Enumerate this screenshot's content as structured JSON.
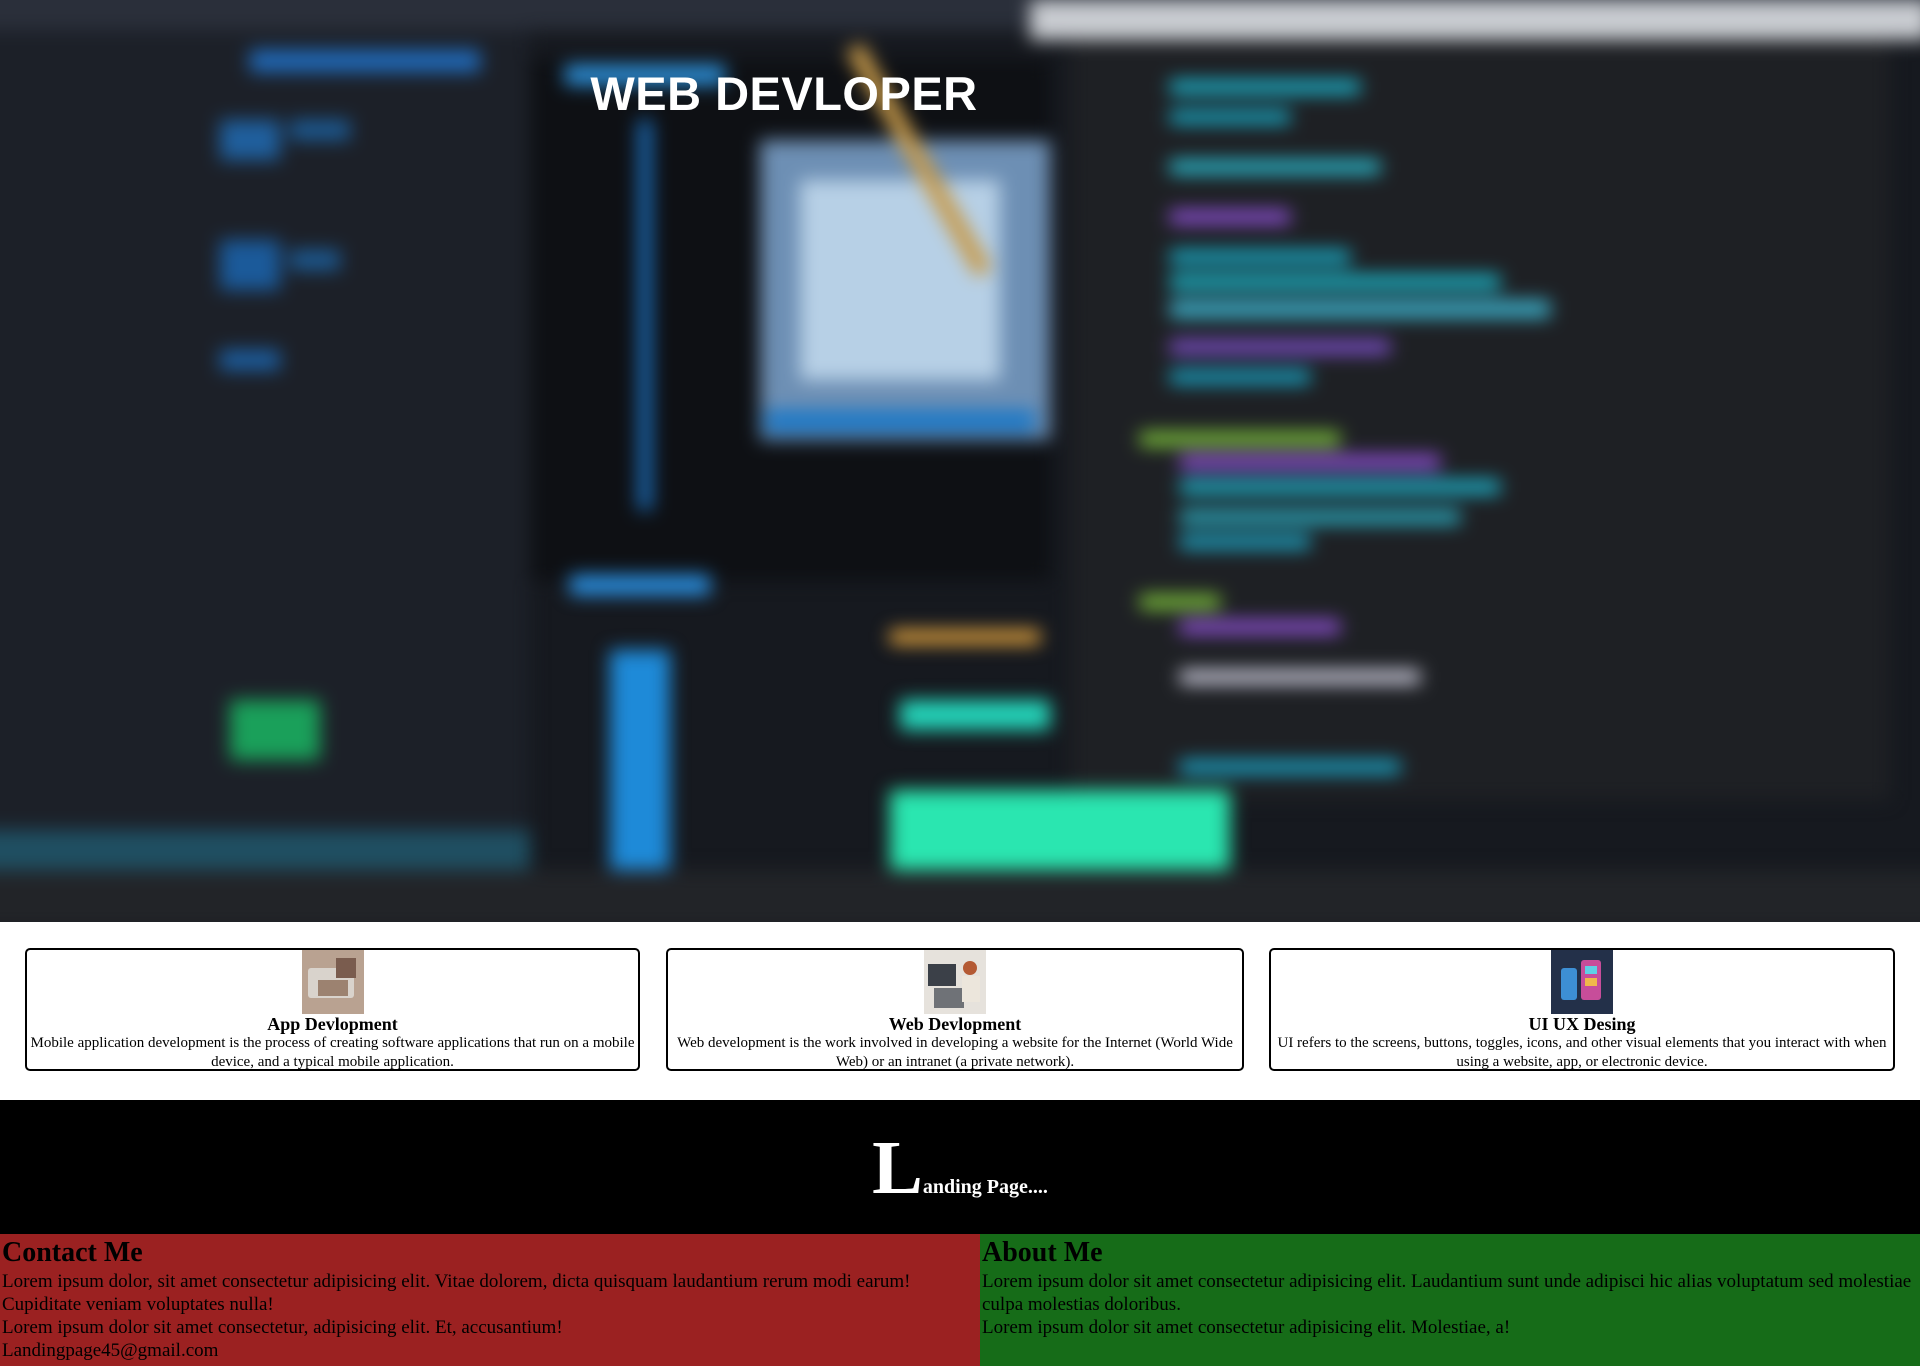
{
  "hero": {
    "title": "WEB DEVLOPER"
  },
  "cards": [
    {
      "title": "App Devlopment",
      "text": "Mobile application development is the process of creating software applications that run on a mobile device, and a typical mobile application.",
      "thumb_icon": "phone-laptop-photo"
    },
    {
      "title": "Web Devlopment",
      "text": "Web development is the work involved in developing a website for the Internet (World Wide Web) or an intranet (a private network).",
      "thumb_icon": "desk-photo"
    },
    {
      "title": "UI UX Desing",
      "text": "UI refers to the screens, buttons, toggles, icons, and other visual elements that you interact with when using a website, app, or electronic device.",
      "thumb_icon": "phone-ui-photo"
    }
  ],
  "landing": {
    "big_letter": "L",
    "rest": "anding Page...."
  },
  "contact": {
    "heading": "Contact Me",
    "line1": "Lorem ipsum dolor, sit amet consectetur adipisicing elit. Vitae dolorem, dicta quisquam laudantium rerum modi earum! Cupiditate veniam voluptates nulla!",
    "line2": "Lorem ipsum dolor sit amet consectetur, adipisicing elit. Et, accusantium!",
    "email": "Landingpage45@gmail.com"
  },
  "about": {
    "heading": "About Me",
    "line1": "Lorem ipsum dolor sit amet consectetur adipisicing elit. Laudantium sunt unde adipisci hic alias voluptatum sed molestiae culpa molestias doloribus.",
    "line2": "Lorem ipsum dolor sit amet consectetur adipisicing elit. Molestiae, a!"
  },
  "colors": {
    "contact_bg": "#9b2121",
    "about_bg": "#166c18",
    "landing_bg": "#000000"
  }
}
